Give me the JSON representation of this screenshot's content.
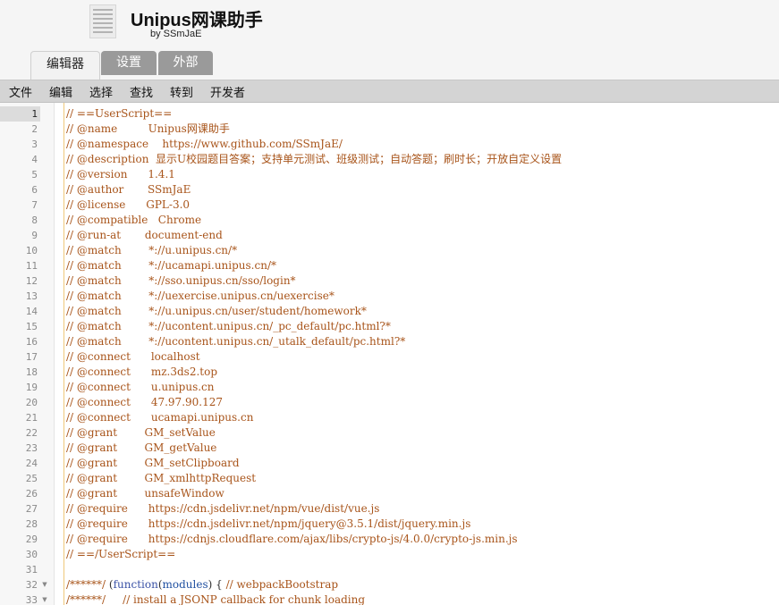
{
  "app": {
    "title": "Unipus网课助手",
    "subtitle": "by SSmJaE"
  },
  "tabs": [
    {
      "label": "编辑器",
      "active": true
    },
    {
      "label": "设置",
      "active": false
    },
    {
      "label": "外部",
      "active": false
    }
  ],
  "menu": [
    "文件",
    "编辑",
    "选择",
    "查找",
    "转到",
    "开发者"
  ],
  "editor": {
    "active_line": 1,
    "lines": [
      {
        "num": "1",
        "text": "// ==UserScript=="
      },
      {
        "num": "2",
        "text": "// @name         Unipus网课助手"
      },
      {
        "num": "3",
        "text": "// @namespace    https://www.github.com/SSmJaE/"
      },
      {
        "num": "4",
        "text": "// @description  显示U校园题目答案；支持单元测试、班级测试；自动答题；刷时长；开放自定义设置"
      },
      {
        "num": "5",
        "text": "// @version      1.4.1"
      },
      {
        "num": "6",
        "text": "// @author       SSmJaE"
      },
      {
        "num": "7",
        "text": "// @license      GPL-3.0"
      },
      {
        "num": "8",
        "text": "// @compatible   Chrome"
      },
      {
        "num": "9",
        "text": "// @run-at       document-end"
      },
      {
        "num": "10",
        "text": "// @match        *://u.unipus.cn/*"
      },
      {
        "num": "11",
        "text": "// @match        *://ucamapi.unipus.cn/*"
      },
      {
        "num": "12",
        "text": "// @match        *://sso.unipus.cn/sso/login*"
      },
      {
        "num": "13",
        "text": "// @match        *://uexercise.unipus.cn/uexercise*"
      },
      {
        "num": "14",
        "text": "// @match        *://u.unipus.cn/user/student/homework*"
      },
      {
        "num": "15",
        "text": "// @match        *://ucontent.unipus.cn/_pc_default/pc.html?*"
      },
      {
        "num": "16",
        "text": "// @match        *://ucontent.unipus.cn/_utalk_default/pc.html?*"
      },
      {
        "num": "17",
        "text": "// @connect      localhost"
      },
      {
        "num": "18",
        "text": "// @connect      mz.3ds2.top"
      },
      {
        "num": "19",
        "text": "// @connect      u.unipus.cn"
      },
      {
        "num": "20",
        "text": "// @connect      47.97.90.127"
      },
      {
        "num": "21",
        "text": "// @connect      ucamapi.unipus.cn"
      },
      {
        "num": "22",
        "text": "// @grant        GM_setValue"
      },
      {
        "num": "23",
        "text": "// @grant        GM_getValue"
      },
      {
        "num": "24",
        "text": "// @grant        GM_setClipboard"
      },
      {
        "num": "25",
        "text": "// @grant        GM_xmlhttpRequest"
      },
      {
        "num": "26",
        "text": "// @grant        unsafeWindow"
      },
      {
        "num": "27",
        "text": "// @require      https://cdn.jsdelivr.net/npm/vue/dist/vue.js"
      },
      {
        "num": "28",
        "text": "// @require      https://cdn.jsdelivr.net/npm/jquery@3.5.1/dist/jquery.min.js"
      },
      {
        "num": "29",
        "text": "// @require      https://cdnjs.cloudflare.com/ajax/libs/crypto-js/4.0.0/crypto-js.min.js"
      },
      {
        "num": "30",
        "text": "// ==/UserScript=="
      },
      {
        "num": "31",
        "text": ""
      },
      {
        "num": "32",
        "text": "/******/ (function(modules) { // webpackBootstrap",
        "fold": true
      },
      {
        "num": "33",
        "text": "/******/ \t// install a JSONP callback for chunk loading",
        "fold": true
      }
    ]
  },
  "colors": {
    "comment": "#a8541a",
    "keyword": "#3a52a6",
    "menubar": "#d4d4d4",
    "tab_inactive": "#9a9a9a"
  }
}
